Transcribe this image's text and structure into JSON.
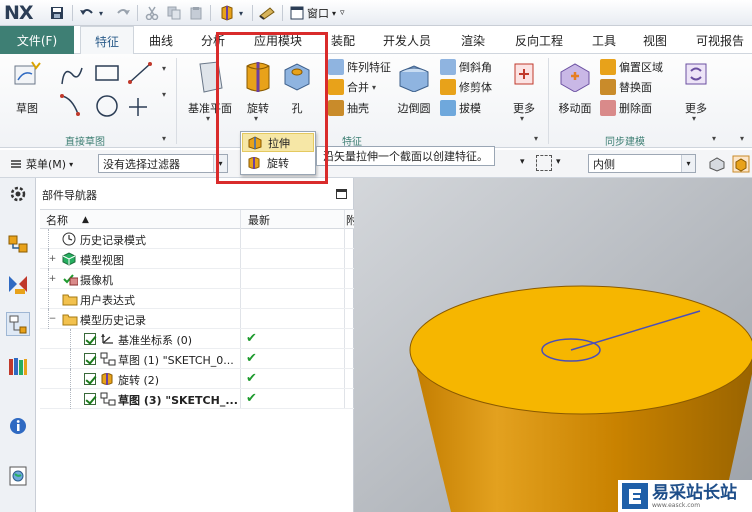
{
  "app": {
    "logo": "NX"
  },
  "quick_access": {
    "icons": [
      "save-icon",
      "undo-icon",
      "redo-icon",
      "cut-icon",
      "copy-icon",
      "paste-icon",
      "revolve-icon",
      "command-finder-icon",
      "window-icon"
    ],
    "window_menu": "窗口"
  },
  "tabs": {
    "file": "文件(F)",
    "items": [
      "特征",
      "曲线",
      "分析",
      "应用模块",
      "装配",
      "开发人员",
      "渲染",
      "反向工程",
      "工具",
      "视图",
      "可视报告"
    ],
    "active": "特征"
  },
  "ribbon": {
    "direct_sketch": {
      "sketch": "草图",
      "label": "直接草图"
    },
    "feature": {
      "datum_plane": "基准平面",
      "revolve": "旋转",
      "hole": "孔",
      "pattern_feature": "阵列特征",
      "unite": "合并",
      "shell": "抽壳",
      "edge_blend": "边倒圆",
      "chamfer": "倒斜角",
      "trim_body": "修剪体",
      "draft": "拔模",
      "more": "更多",
      "label": "特征"
    },
    "sync_modeling": {
      "move_face": "移动面",
      "offset_region": "偏置区域",
      "replace_face": "替换面",
      "delete_face": "删除面",
      "more": "更多",
      "label": "同步建模"
    }
  },
  "dropdown": {
    "items": [
      {
        "label": "拉伸",
        "icon": "extrude-icon"
      },
      {
        "label": "旋转",
        "icon": "revolve-icon"
      }
    ],
    "tooltip": "沿矢量拉伸一个截面以创建特征。"
  },
  "selection_bar": {
    "menu": "菜单(M)",
    "filter": "没有选择过滤器",
    "scope": "内侧"
  },
  "navigator": {
    "title": "部件导航器",
    "col_name": "名称",
    "col_latest": "最新",
    "col_extra": "附",
    "rows": [
      {
        "label": "历史记录模式",
        "icon": "clock-icon",
        "indent": 0,
        "expander": "",
        "checked": false,
        "latest": ""
      },
      {
        "label": "模型视图",
        "icon": "model-view-icon",
        "indent": 0,
        "expander": "+",
        "checked": false,
        "latest": ""
      },
      {
        "label": "摄像机",
        "icon": "camera-icon",
        "indent": 0,
        "expander": "+",
        "checked": false,
        "latest": ""
      },
      {
        "label": "用户表达式",
        "icon": "folder-icon",
        "indent": 0,
        "expander": "",
        "checked": false,
        "latest": ""
      },
      {
        "label": "模型历史记录",
        "icon": "folder-icon",
        "indent": 0,
        "expander": "−",
        "checked": false,
        "latest": ""
      },
      {
        "label": "基准坐标系 (0)",
        "icon": "csys-icon",
        "indent": 1,
        "expander": "",
        "checked": true,
        "latest": "✔"
      },
      {
        "label": "草图 (1) \"SKETCH_0...",
        "icon": "sketch-icon",
        "indent": 1,
        "expander": "",
        "checked": true,
        "latest": "✔"
      },
      {
        "label": "旋转 (2)",
        "icon": "revolve-icon",
        "indent": 1,
        "expander": "",
        "checked": true,
        "latest": "✔"
      },
      {
        "label": "草图 (3) \"SKETCH_...",
        "icon": "sketch-icon",
        "indent": 1,
        "expander": "",
        "checked": true,
        "latest": "✔",
        "bold": true
      }
    ]
  },
  "watermark": {
    "text": "易采站长站",
    "sub": "www.easck.com"
  },
  "colors": {
    "file_tab": "#3e7f74",
    "highlight": "#d92b2b",
    "model_top": "#f4b400",
    "model_side": "#d08800",
    "viewport_bg": "#b5b9bf",
    "tick": "#1e9a2e"
  }
}
